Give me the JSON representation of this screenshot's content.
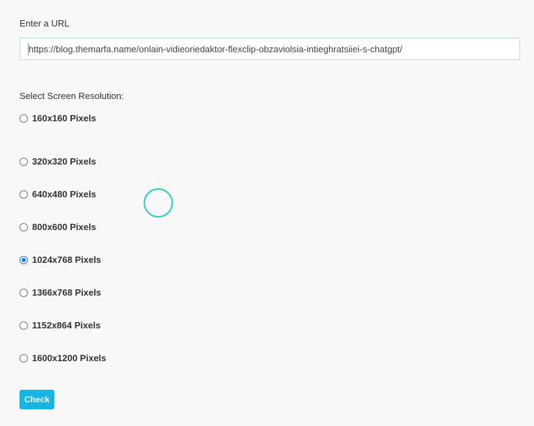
{
  "url_section": {
    "label": "Enter a URL",
    "value": "https://blog.themarfa.name/onlain-vidieoriedaktor-flexclip-obzaviolsia-intieghratsiiei-s-chatgpt/"
  },
  "resolution_section": {
    "label": "Select Screen Resolution:",
    "options": [
      {
        "label": "160x160 Pixels",
        "checked": false
      },
      {
        "label": "320x320 Pixels",
        "checked": false
      },
      {
        "label": "640x480 Pixels",
        "checked": false
      },
      {
        "label": "800x600 Pixels",
        "checked": false
      },
      {
        "label": "1024x768 Pixels",
        "checked": true
      },
      {
        "label": "1366x768 Pixels",
        "checked": false
      },
      {
        "label": "1152x864 Pixels",
        "checked": false
      },
      {
        "label": "1600x1200 Pixels",
        "checked": false
      }
    ]
  },
  "actions": {
    "check_label": "Check"
  },
  "colors": {
    "button": "#15b6e6",
    "cursor_ring": "#1fd1c0",
    "radio_checked": "#1a73e8"
  }
}
